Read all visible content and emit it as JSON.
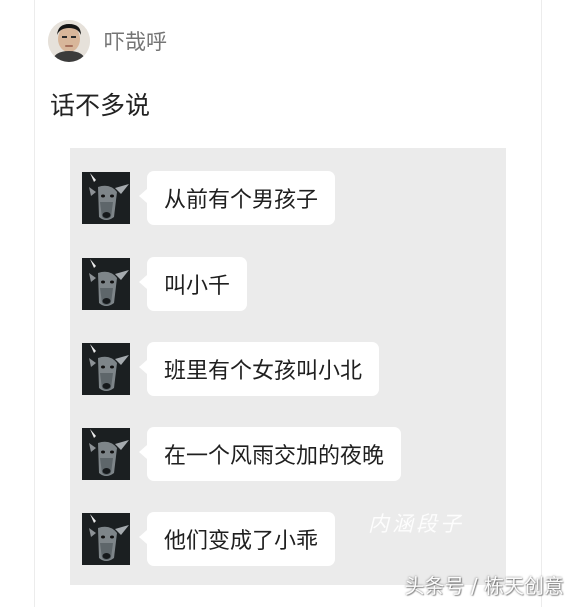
{
  "post": {
    "author_name": "吓哉呼",
    "text": "话不多说"
  },
  "chat": {
    "messages": [
      {
        "text": "从前有个男孩子"
      },
      {
        "text": "叫小千"
      },
      {
        "text": "班里有个女孩叫小北"
      },
      {
        "text": "在一个风雨交加的夜晚"
      },
      {
        "text": "他们变成了小乖"
      }
    ]
  },
  "watermarks": {
    "handwritten": "内涵段子",
    "source": "头条号 / 栋天创意"
  },
  "icons": {
    "poster_avatar": "person-avatar-icon",
    "chat_avatar": "deer-avatar-icon"
  }
}
